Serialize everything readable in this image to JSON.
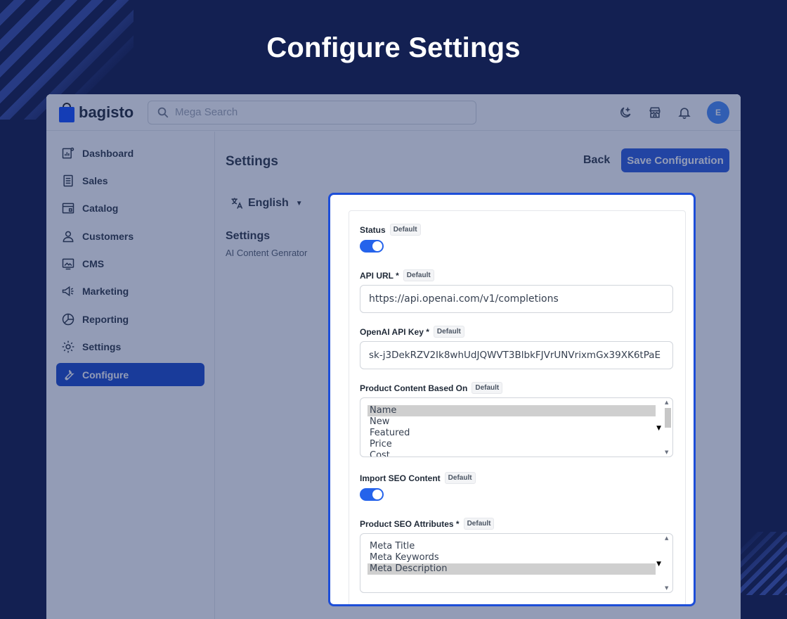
{
  "page_heading": "Configure Settings",
  "app": {
    "logo_text": "bagisto",
    "search_placeholder": "Mega Search",
    "user_initial": "E",
    "top_icons": [
      "theme-toggle-icon",
      "store-icon",
      "bell-icon"
    ]
  },
  "sidebar": {
    "items": [
      {
        "label": "Dashboard",
        "icon": "dashboard-icon",
        "active": false
      },
      {
        "label": "Sales",
        "icon": "sales-icon",
        "active": false
      },
      {
        "label": "Catalog",
        "icon": "catalog-icon",
        "active": false
      },
      {
        "label": "Customers",
        "icon": "customers-icon",
        "active": false
      },
      {
        "label": "CMS",
        "icon": "cms-icon",
        "active": false
      },
      {
        "label": "Marketing",
        "icon": "marketing-icon",
        "active": false
      },
      {
        "label": "Reporting",
        "icon": "reporting-icon",
        "active": false
      },
      {
        "label": "Settings",
        "icon": "settings-icon",
        "active": false
      },
      {
        "label": "Configure",
        "icon": "wrench-icon",
        "active": true
      }
    ]
  },
  "main": {
    "title": "Settings",
    "back_label": "Back",
    "save_label": "Save Configuration",
    "locale": "English",
    "group_title": "Settings",
    "group_sub": "AI Content Genrator"
  },
  "form": {
    "default_badge": "Default",
    "status_label": "Status",
    "status_on": true,
    "api_url_label": "API URL *",
    "api_url_value": "https://api.openai.com/v1/completions",
    "api_key_label": "OpenAI API Key *",
    "api_key_value": "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",
    "product_content_label": "Product Content Based On",
    "product_content_options": [
      "Name",
      "New",
      "Featured",
      "Price",
      "Cost"
    ],
    "product_content_selected": "Name",
    "import_seo_label": "Import SEO Content",
    "import_seo_on": true,
    "seo_attrs_label": "Product SEO Attributes *",
    "seo_attrs_options": [
      "Meta Title",
      "Meta Keywords",
      "Meta Description"
    ],
    "seo_attrs_selected": "Meta Description"
  },
  "colors": {
    "background": "#132052",
    "accent": "#1d4ed8",
    "active_nav": "#0a3cc7",
    "logo_blue": "#0041ff"
  }
}
